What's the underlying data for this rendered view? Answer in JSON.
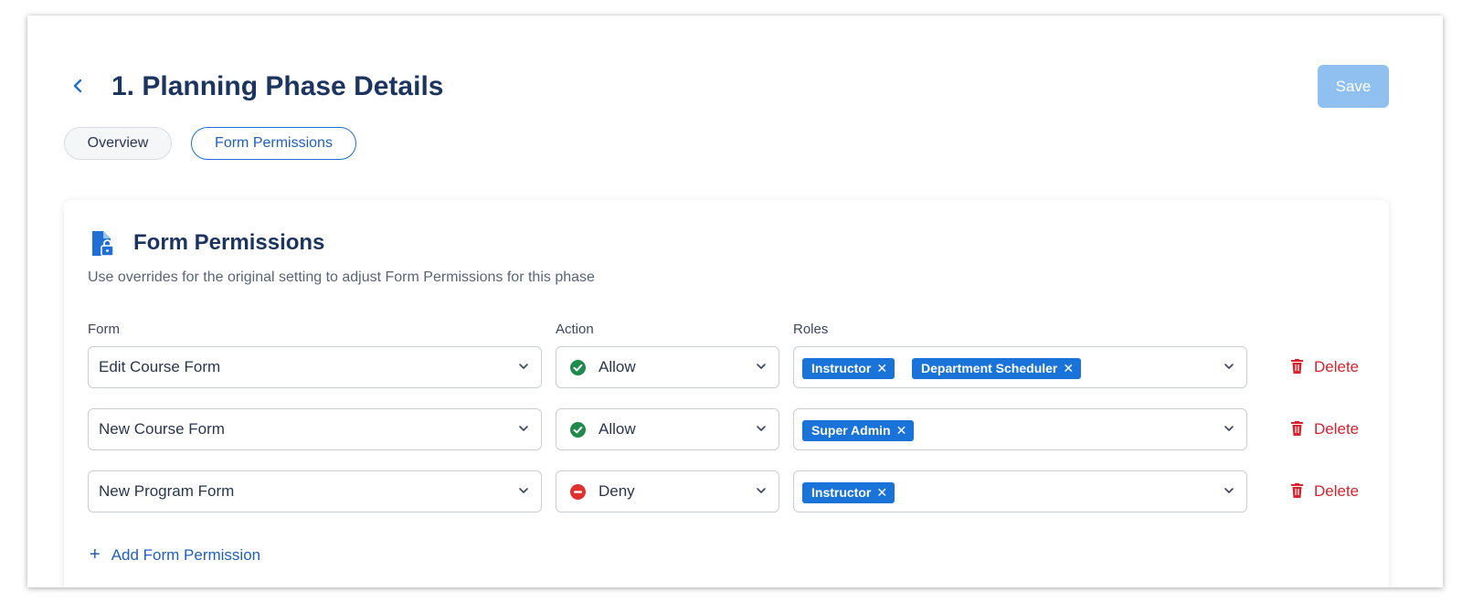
{
  "header": {
    "title": "1. Planning Phase Details",
    "save_label": "Save"
  },
  "tabs": [
    {
      "label": "Overview",
      "active": false
    },
    {
      "label": "Form Permissions",
      "active": true
    }
  ],
  "card": {
    "title": "Form Permissions",
    "description": "Use overrides for the original setting to adjust Form Permissions for this phase",
    "columns": {
      "form": "Form",
      "action": "Action",
      "roles": "Roles"
    },
    "rows": [
      {
        "form": "Edit Course Form",
        "action": "Allow",
        "action_status": "allow",
        "roles": [
          "Instructor",
          "Department Scheduler"
        ],
        "delete_label": "Delete"
      },
      {
        "form": "New Course Form",
        "action": "Allow",
        "action_status": "allow",
        "roles": [
          "Super Admin"
        ],
        "delete_label": "Delete"
      },
      {
        "form": "New Program Form",
        "action": "Deny",
        "action_status": "deny",
        "roles": [
          "Instructor"
        ],
        "delete_label": "Delete"
      }
    ],
    "add_label": "Add Form Permission"
  },
  "colors": {
    "primary": "#1f6fd6",
    "title": "#1c3460",
    "save_disabled": "#8fc0f0",
    "allow": "#1e8a4c",
    "deny": "#e0312f",
    "delete": "#d6232f",
    "tag": "#1a73d9"
  },
  "icons": {
    "back": "chevron-left-icon",
    "card": "file-lock-icon",
    "dropdown": "chevron-down-icon",
    "allow": "check-circle-icon",
    "deny": "minus-circle-icon",
    "delete": "trash-icon",
    "add": "plus-icon",
    "tag_remove": "close-icon"
  }
}
